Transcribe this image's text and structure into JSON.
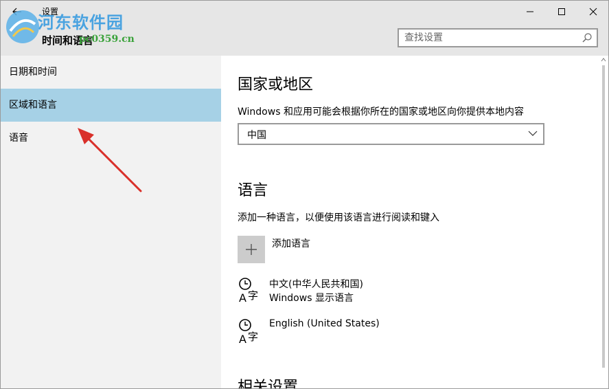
{
  "titlebar": {
    "app_title": "设置",
    "back_icon": "back-arrow-icon",
    "minimize_icon": "minimize-icon",
    "maximize_icon": "maximize-icon",
    "close_icon": "close-icon"
  },
  "header": {
    "page_title": "时间和语言",
    "search_placeholder": "查找设置",
    "search_icon": "search-icon"
  },
  "watermark": {
    "name": "河东软件园",
    "url": "pc0359.cn"
  },
  "sidebar": {
    "items": [
      {
        "label": "日期和时间",
        "selected": false
      },
      {
        "label": "区域和语言",
        "selected": true
      },
      {
        "label": "语音",
        "selected": false
      }
    ]
  },
  "main": {
    "region": {
      "heading": "国家或地区",
      "description": "Windows 和应用可能会根据你所在的国家或地区向你提供本地内容",
      "selected_value": "中国"
    },
    "languages": {
      "heading": "语言",
      "description": "添加一种语言，以便使用该语言进行阅读和键入",
      "add_label": "添加语言",
      "items": [
        {
          "name": "中文(中华人民共和国)",
          "sub": "Windows 显示语言",
          "icon": "language-icon"
        },
        {
          "name": "English (United States)",
          "sub": "",
          "icon": "language-icon"
        }
      ]
    },
    "related": {
      "heading": "相关设置"
    }
  },
  "colors": {
    "selected_nav": "#a6d1e6",
    "sidebar_bg": "#f2f2f2",
    "titlebar_bg": "#e6e6e6",
    "annotation_arrow": "#d9302a"
  }
}
